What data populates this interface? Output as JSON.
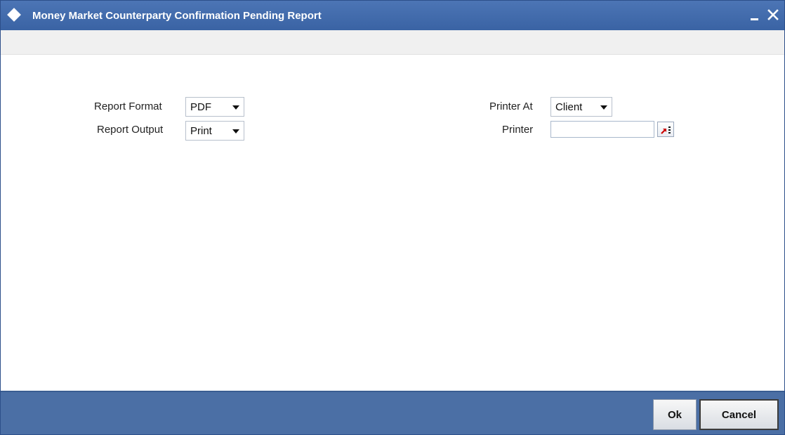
{
  "window": {
    "title": "Money Market Counterparty Confirmation Pending Report"
  },
  "form": {
    "report_format": {
      "label": "Report Format",
      "value": "PDF"
    },
    "report_output": {
      "label": "Report Output",
      "value": "Print"
    },
    "printer_at": {
      "label": "Printer At",
      "value": "Client"
    },
    "printer": {
      "label": "Printer",
      "value": ""
    }
  },
  "footer": {
    "ok_label": "Ok",
    "cancel_label": "Cancel"
  },
  "icons": {
    "title": "diamond-icon",
    "minimize": "minimize-icon",
    "close": "close-icon",
    "lov": "list-of-values-icon",
    "dropdown": "chevron-down-icon"
  },
  "colors": {
    "titlebar": "#3f68aa",
    "footer": "#4b6fa5",
    "toolbar_strip": "#f0f0f0",
    "lov_arrow": "#cc0000"
  }
}
